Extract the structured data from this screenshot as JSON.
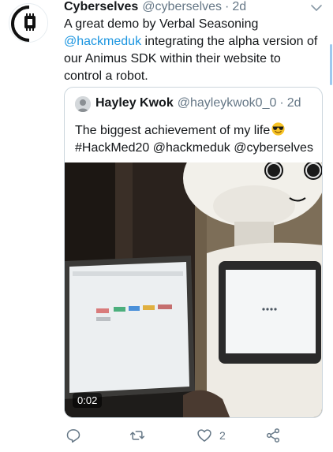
{
  "tweet": {
    "author_name": "Cyberselves",
    "author_handle": "@cyberselves",
    "separator": "·",
    "time": "2d",
    "text": {
      "line1": "A great demo by Verbal Seasoning",
      "line2_mention": "@hackmeduk",
      "line2_rest": " integrating the alpha version of",
      "line3": "our Animus SDK within their website to",
      "line4": "control a robot."
    }
  },
  "quote": {
    "author_name": "Hayley Kwok",
    "author_handle": "@hayleykwok0_0",
    "separator": "·",
    "time": "2d",
    "text": {
      "line1": "The biggest achievement of my life",
      "line2": "#HackMed20 @hackmeduk @cyberselves"
    },
    "emoji": "smiling-face-with-sunglasses",
    "video": {
      "duration": "0:02"
    }
  },
  "actions": {
    "reply_icon": "reply-icon",
    "retweet_icon": "retweet-icon",
    "like_icon": "heart-icon",
    "like_count": "2",
    "share_icon": "share-icon"
  },
  "colors": {
    "text": "#14171a",
    "secondary": "#657786",
    "link": "#1b95e0",
    "border": "#ccd6dd"
  }
}
